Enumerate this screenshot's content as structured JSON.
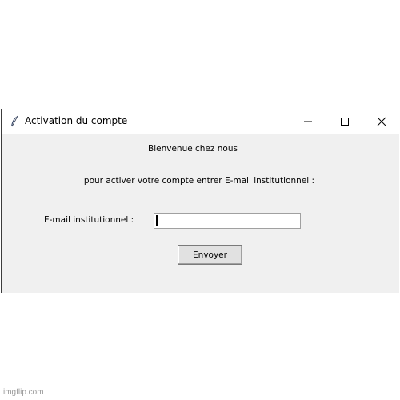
{
  "window": {
    "title": "Activation du compte",
    "controls": {
      "minimize_icon": "minimize-icon",
      "maximize_icon": "maximize-icon",
      "close_icon": "close-icon"
    },
    "app_icon": "feather-icon"
  },
  "form": {
    "welcome_text": "Bienvenue chez nous",
    "instruction_text": "pour activer votre compte entrer E-mail institutionnel :",
    "email_label": "E-mail institutionnel :",
    "email_value": "",
    "send_button_label": "Envoyer"
  },
  "watermark": "imgflip.com",
  "colors": {
    "window_bg": "#f0f0f0",
    "titlebar_bg": "#ffffff",
    "button_bg": "#e1e1e1"
  }
}
